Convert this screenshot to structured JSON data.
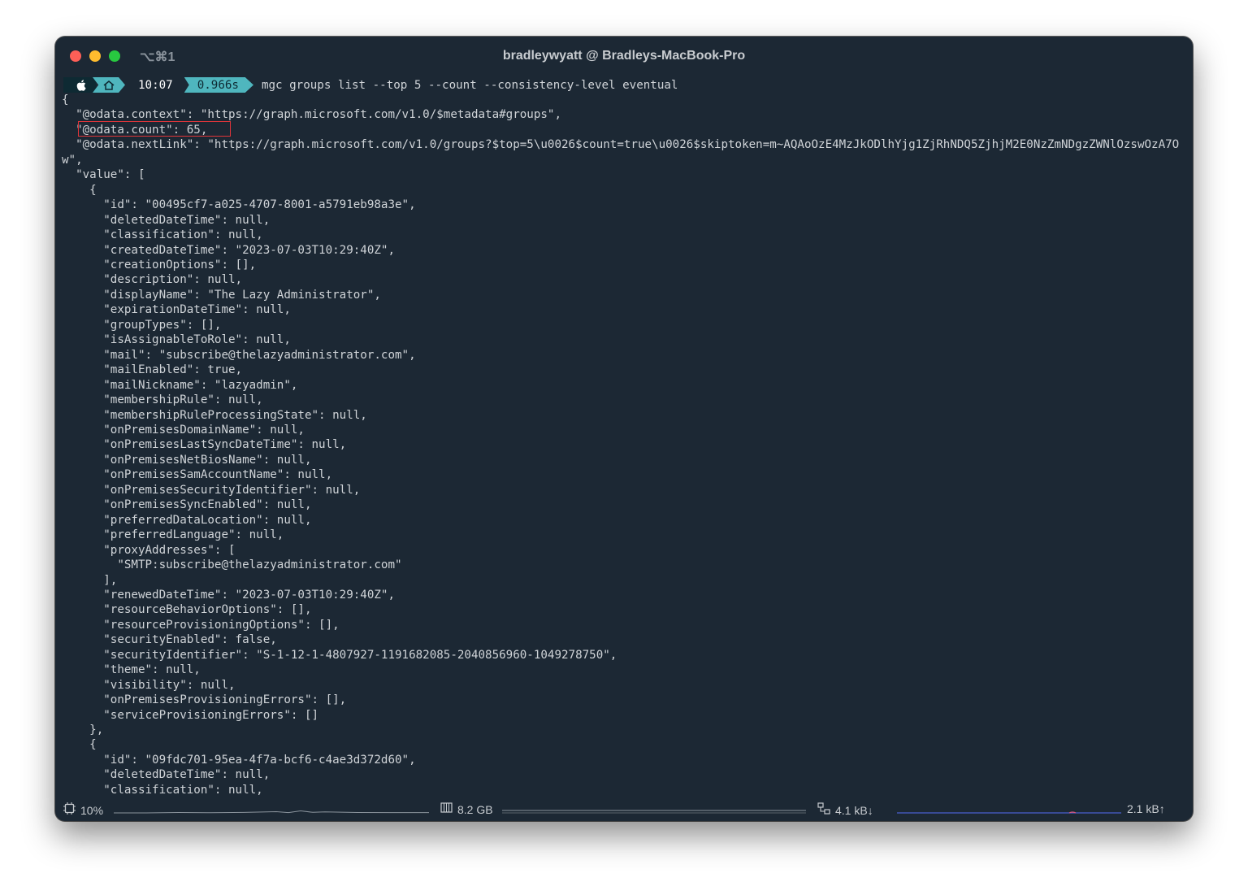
{
  "window": {
    "title": "bradleywyatt @ Bradleys-MacBook-Pro",
    "shortcut": "⌥⌘1",
    "traffic_lights": {
      "close": "#fe5f57",
      "minimize": "#febc2e",
      "zoom": "#28c840"
    }
  },
  "prompt": {
    "apple_icon": "apple-icon",
    "home_icon": "home-icon",
    "time": "10:07",
    "duration": "0.966s",
    "command": "mgc groups list --top 5 --count --consistency-level eventual"
  },
  "output_lines": [
    "{",
    "  \"@odata.context\": \"https://graph.microsoft.com/v1.0/$metadata#groups\",",
    "  \"@odata.count\": 65,",
    "  \"@odata.nextLink\": \"https://graph.microsoft.com/v1.0/groups?$top=5\\u0026$count=true\\u0026$skiptoken=m~AQAoOzE4MzJkODlhYjg1ZjRhNDQ5ZjhjM2E0NzZmNDgzZWNlOzswOzA7O",
    "w\",",
    "  \"value\": [",
    "    {",
    "      \"id\": \"00495cf7-a025-4707-8001-a5791eb98a3e\",",
    "      \"deletedDateTime\": null,",
    "      \"classification\": null,",
    "      \"createdDateTime\": \"2023-07-03T10:29:40Z\",",
    "      \"creationOptions\": [],",
    "      \"description\": null,",
    "      \"displayName\": \"The Lazy Administrator\",",
    "      \"expirationDateTime\": null,",
    "      \"groupTypes\": [],",
    "      \"isAssignableToRole\": null,",
    "      \"mail\": \"subscribe@thelazyadministrator.com\",",
    "      \"mailEnabled\": true,",
    "      \"mailNickname\": \"lazyadmin\",",
    "      \"membershipRule\": null,",
    "      \"membershipRuleProcessingState\": null,",
    "      \"onPremisesDomainName\": null,",
    "      \"onPremisesLastSyncDateTime\": null,",
    "      \"onPremisesNetBiosName\": null,",
    "      \"onPremisesSamAccountName\": null,",
    "      \"onPremisesSecurityIdentifier\": null,",
    "      \"onPremisesSyncEnabled\": null,",
    "      \"preferredDataLocation\": null,",
    "      \"preferredLanguage\": null,",
    "      \"proxyAddresses\": [",
    "        \"SMTP:subscribe@thelazyadministrator.com\"",
    "      ],",
    "      \"renewedDateTime\": \"2023-07-03T10:29:40Z\",",
    "      \"resourceBehaviorOptions\": [],",
    "      \"resourceProvisioningOptions\": [],",
    "      \"securityEnabled\": false,",
    "      \"securityIdentifier\": \"S-1-12-1-4807927-1191682085-2040856960-1049278750\",",
    "      \"theme\": null,",
    "      \"visibility\": null,",
    "      \"onPremisesProvisioningErrors\": [],",
    "      \"serviceProvisioningErrors\": []",
    "    },",
    "    {",
    "      \"id\": \"09fdc701-95ea-4f7a-bcf6-c4ae3d372d60\",",
    "      \"deletedDateTime\": null,",
    "      \"classification\": null,"
  ],
  "statusbar": {
    "cpu": {
      "icon": "cpu-icon",
      "label": "10%"
    },
    "memory": {
      "icon": "memory-icon",
      "label": "8.2 GB"
    },
    "network_down": {
      "icon": "network-icon",
      "label": "4.1 kB↓"
    },
    "network_up": {
      "label": "2.1 kB↑"
    }
  },
  "colors": {
    "background": "#1c2834",
    "accent": "#4fb6be",
    "text": "#d0d4d8",
    "highlight_box": "#e0353a"
  }
}
